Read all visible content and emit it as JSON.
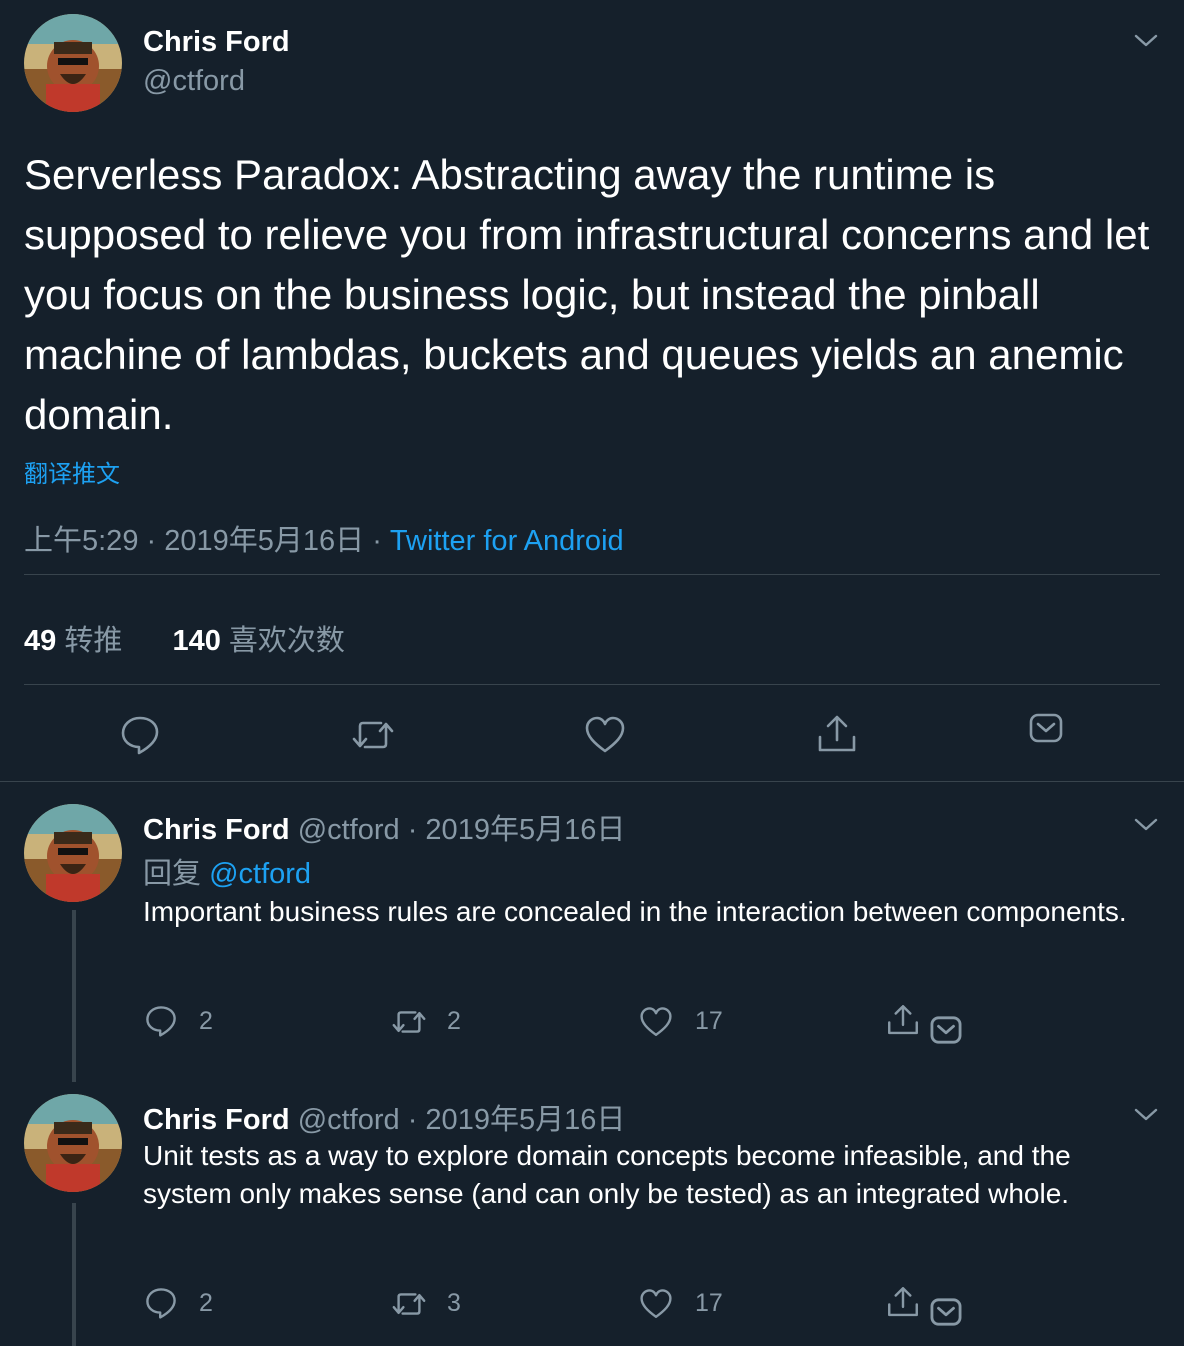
{
  "main_tweet": {
    "display_name": "Chris Ford",
    "handle": "@ctford",
    "text": "Serverless Paradox: Abstracting away the runtime is supposed to relieve you from infrastructural concerns and let you focus on the business logic, but instead the pinball machine of lambdas, buckets and queues yields an anemic domain.",
    "translate_label": "翻译推文",
    "time": "上午5:29 · 2019年5月16日",
    "separator": "·",
    "source": "Twitter for Android",
    "retweets_count": "49",
    "retweets_label": "转推",
    "likes_count": "140",
    "likes_label": "喜欢次数"
  },
  "replies": [
    {
      "display_name": "Chris Ford",
      "handle": "@ctford",
      "date": "· 2019年5月16日",
      "reply_prefix": "回复",
      "reply_to": "@ctford",
      "text": "Important business rules are concealed in the interaction between components.",
      "reply_count": "2",
      "retweet_count": "2",
      "like_count": "17"
    },
    {
      "display_name": "Chris Ford",
      "handle": "@ctford",
      "date": "· 2019年5月16日",
      "text": "Unit tests as a way to explore domain concepts become infeasible, and the system only makes sense (and can only be tested) as an integrated whole.",
      "reply_count": "2",
      "retweet_count": "3",
      "like_count": "17"
    }
  ],
  "colors": {
    "background": "#15202b",
    "accent": "#1da1f2",
    "secondary_text": "#8899a6",
    "divider": "#38444d"
  },
  "icons": [
    "chevron-down-icon",
    "reply-icon",
    "retweet-icon",
    "like-icon",
    "share-icon",
    "save-icon",
    "avatar"
  ]
}
